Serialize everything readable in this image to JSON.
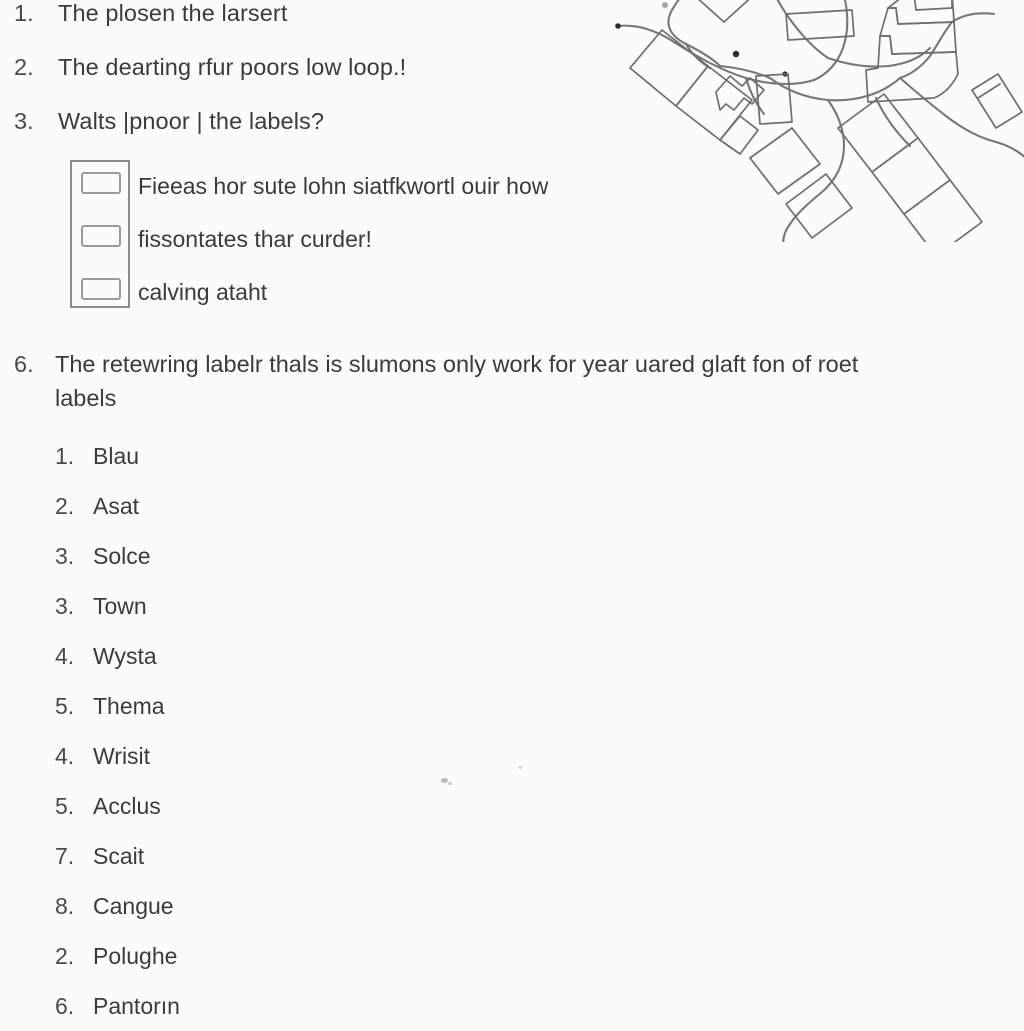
{
  "document": {
    "questions": [
      {
        "number": "1.",
        "text": "The plosen the larsert"
      },
      {
        "number": "2.",
        "text": "The dearting rfur poors low loop.!"
      },
      {
        "number": "3.",
        "text": "Walts |pnoor | the labels?"
      }
    ],
    "checkbox_group": {
      "options": [
        {
          "label": "Fieeas hor sute lohn siatfkwortl ouir how",
          "checked": false
        },
        {
          "label": "fissontates thar curder!",
          "checked": false
        },
        {
          "label": "calving ataht",
          "checked": false
        }
      ]
    },
    "paragraph_item": {
      "number": "6.",
      "line1": "The retewring labelr thals is slumons only work for year uared glaft fon of roet",
      "line2": "labels"
    },
    "sub_list": [
      {
        "number": "1.",
        "label": "Blau"
      },
      {
        "number": "2.",
        "label": "Asat"
      },
      {
        "number": "3.",
        "label": "Solce"
      },
      {
        "number": "3.",
        "label": "Town"
      },
      {
        "number": "4.",
        "label": "Wysta"
      },
      {
        "number": "5.",
        "label": "Thema"
      },
      {
        "number": "4.",
        "label": "Wrisit"
      },
      {
        "number": "5.",
        "label": "Acclus"
      },
      {
        "number": "7.",
        "label": "Scait"
      },
      {
        "number": "8.",
        "label": "Cangue"
      },
      {
        "number": "2.",
        "label": "Polughe"
      },
      {
        "number": "6.",
        "label": "Pantorın"
      }
    ],
    "map": {
      "name": "site-plan-line-drawing",
      "description": "Line-art street map with building footprints and curving roads",
      "stroke_color": "#6e6e70"
    },
    "colors": {
      "page_background": "#fbfbfa",
      "text": "#3b3b3d",
      "rule": "#8a8a8c"
    }
  }
}
